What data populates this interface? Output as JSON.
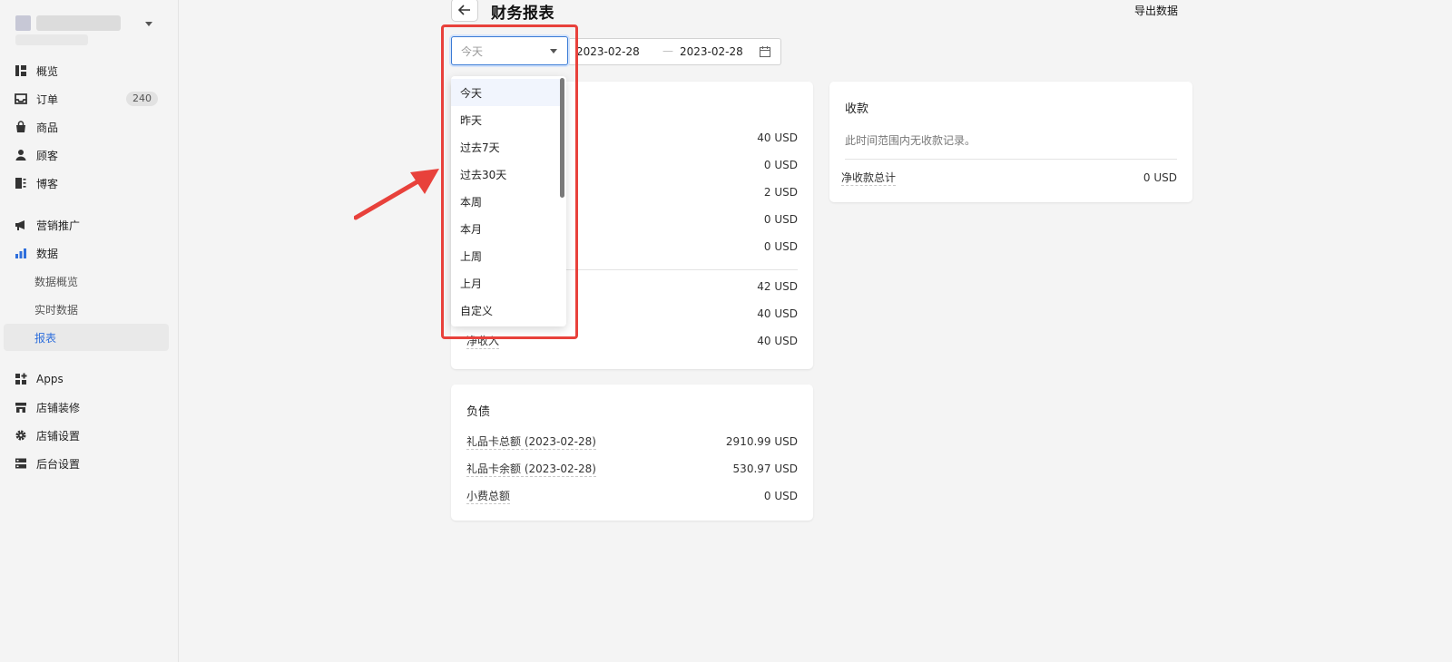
{
  "sidebar": {
    "items": [
      {
        "label": "概览",
        "icon": "overview-icon"
      },
      {
        "label": "订单",
        "icon": "inbox-icon",
        "badge": "240"
      },
      {
        "label": "商品",
        "icon": "bag-icon"
      },
      {
        "label": "顾客",
        "icon": "person-icon"
      },
      {
        "label": "博客",
        "icon": "blog-icon"
      },
      {
        "label": "营销推广",
        "icon": "megaphone-icon"
      },
      {
        "label": "数据",
        "icon": "bar-chart-icon"
      },
      {
        "label": "数据概览",
        "icon": ""
      },
      {
        "label": "实时数据",
        "icon": ""
      },
      {
        "label": "报表",
        "icon": ""
      },
      {
        "label": "Apps",
        "icon": "apps-icon"
      },
      {
        "label": "店铺装修",
        "icon": "storefront-icon"
      },
      {
        "label": "店铺设置",
        "icon": "gear-icon"
      },
      {
        "label": "后台设置",
        "icon": "server-icon"
      }
    ]
  },
  "header": {
    "title": "财务报表",
    "export_label": "导出数据"
  },
  "filter": {
    "range_value": "今天",
    "date_start": "2023-02-28",
    "date_sep": "—",
    "date_end": "2023-02-28"
  },
  "dropdown": {
    "options": [
      "今天",
      "昨天",
      "过去7天",
      "过去30天",
      "本周",
      "本月",
      "上周",
      "上月",
      "自定义"
    ],
    "selected_index": 0
  },
  "sales_card": {
    "rows_visible_values": [
      "40 USD",
      "0 USD",
      "2 USD",
      "0 USD",
      "0 USD"
    ],
    "total_values": [
      "42 USD",
      "40 USD"
    ],
    "net_income_label": "净收入",
    "net_income_value": "40 USD"
  },
  "payments_card": {
    "title": "收款",
    "empty_text": "此时间范围内无收款记录。",
    "total_label": "净收款总计",
    "total_value": "0 USD"
  },
  "liabilities_card": {
    "title": "负债",
    "rows": [
      {
        "label": "礼品卡总额 (2023-02-28)",
        "value": "2910.99 USD"
      },
      {
        "label": "礼品卡余额 (2023-02-28)",
        "value": "530.97 USD"
      },
      {
        "label": "小费总额",
        "value": "0 USD"
      }
    ]
  },
  "colors": {
    "accent": "#2f6fdc",
    "annotation": "#e8413b"
  }
}
